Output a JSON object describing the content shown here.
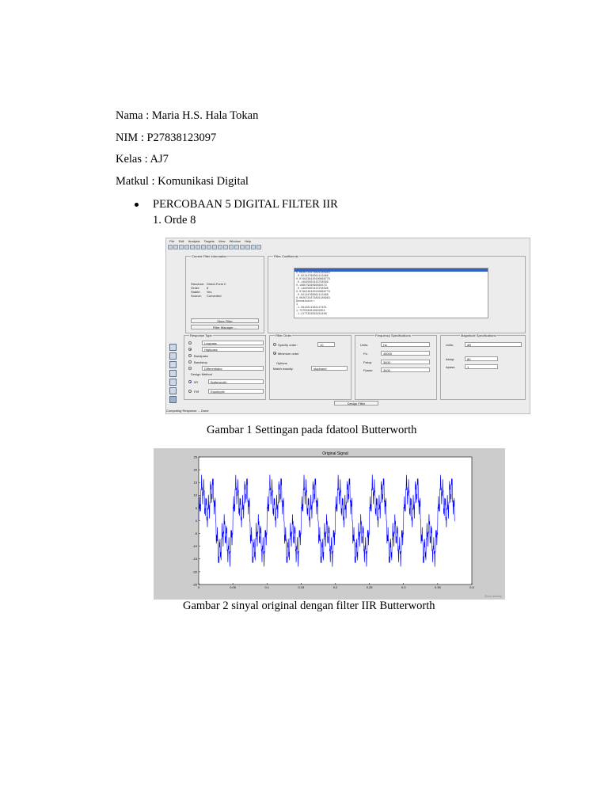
{
  "doc": {
    "nama": "Nama : Maria H.S. Hala Tokan",
    "nim": "NIM : P27838123097",
    "kelas": "Kelas : AJ7",
    "matkul": "Matkul : Komunikasi Digital",
    "bullet": "PERCOBAAN 5 DIGITAL FILTER IIR",
    "numbered": "1.   Orde 8",
    "caption1": "Gambar 1 Settingan pada fdatool Butterworth",
    "caption2": "Gambar 2 sinyal original dengan filter IIR Butterworth"
  },
  "fdatool": {
    "menu": [
      "File",
      "Edit",
      "Analysis",
      "Targets",
      "View",
      "Window",
      "Help"
    ],
    "current_filter": {
      "title": "Current Filter Information",
      "rows": [
        {
          "k": "Structure:",
          "v": "Direct-Form II"
        },
        {
          "k": "Order:",
          "v": "8"
        },
        {
          "k": "Stable:",
          "v": "Yes"
        },
        {
          "k": "Source:",
          "v": "Converted"
        }
      ],
      "store_btn": "Store Filter",
      "manager_btn": "Filter Manager ..."
    },
    "coefficients": {
      "title": "Filter Coefficients",
      "lines": [
        "",
        "0.0026724473891180983",
        "-0.02134796091113468",
        "0.0746238420100868776",
        "-0.14935603433758596",
        "0.18667939096864573",
        "-0.14935603433758596",
        "0.0746238420100868776",
        "-0.02134796091113468",
        "0.0026724473891180983",
        "Denominator:",
        "1",
        "-1.5812811262127451",
        "1.7375582810602855",
        "-1.2177322833452408"
      ]
    },
    "response_type": {
      "title": "Response Type",
      "options": [
        "Lowpass",
        "Highpass",
        "Bandpass",
        "Bandstop",
        "Differentiator"
      ],
      "selected": "Highpass"
    },
    "design_method": {
      "title": "Design Method",
      "iir_label": "IIR",
      "iir_value": "Butterworth",
      "fir_label": "FIR",
      "fir_value": "Equiripple"
    },
    "filter_order": {
      "title": "Filter Order",
      "specify": "Specify order:",
      "specify_value": "10",
      "minimum": "Minimum order",
      "options_title": "Options",
      "match_label": "Match exactly:",
      "match_value": "stopband"
    },
    "freq_specs": {
      "title": "Frequency Specifications",
      "units_label": "Units:",
      "units_value": "Hz",
      "fs_label": "Fs:",
      "fs_value": "48000",
      "fstop_label": "Fstop:",
      "fstop_value": "3400",
      "fpass_label": "Fpass:",
      "fpass_value": "3400"
    },
    "mag_specs": {
      "title": "Magnitude Specifications",
      "units_label": "Units:",
      "units_value": "dB",
      "astop_label": "Astop:",
      "astop_value": "80",
      "apass_label": "Apass:",
      "apass_value": "1"
    },
    "design_btn": "Design Filter",
    "status": "Computing Response ... Done"
  },
  "chart_data": {
    "type": "line",
    "title": "Original Signal",
    "xlabel": "",
    "ylabel": "",
    "xlim": [
      0,
      0.4
    ],
    "ylim": [
      -25,
      25
    ],
    "xticks": [
      "0",
      "0.05",
      "0.1",
      "0.15",
      "0.2",
      "0.25",
      "0.3",
      "0.35",
      "0.4"
    ],
    "yticks": [
      "25",
      "20",
      "15",
      "10",
      "5",
      "0",
      "-5",
      "-10",
      "-15",
      "-20",
      "-25"
    ],
    "series": [
      {
        "color": "#0000ff",
        "x_range": [
          0,
          0.375
        ],
        "components": [
          {
            "amp": 10,
            "freq_hz": 20
          },
          {
            "amp": 7,
            "freq_hz": 60
          },
          {
            "amp": 4,
            "freq_hz": 300
          },
          {
            "amp": 2,
            "freq_hz": 1000
          }
        ]
      }
    ],
    "grid": false,
    "footer": "Show desktop"
  }
}
